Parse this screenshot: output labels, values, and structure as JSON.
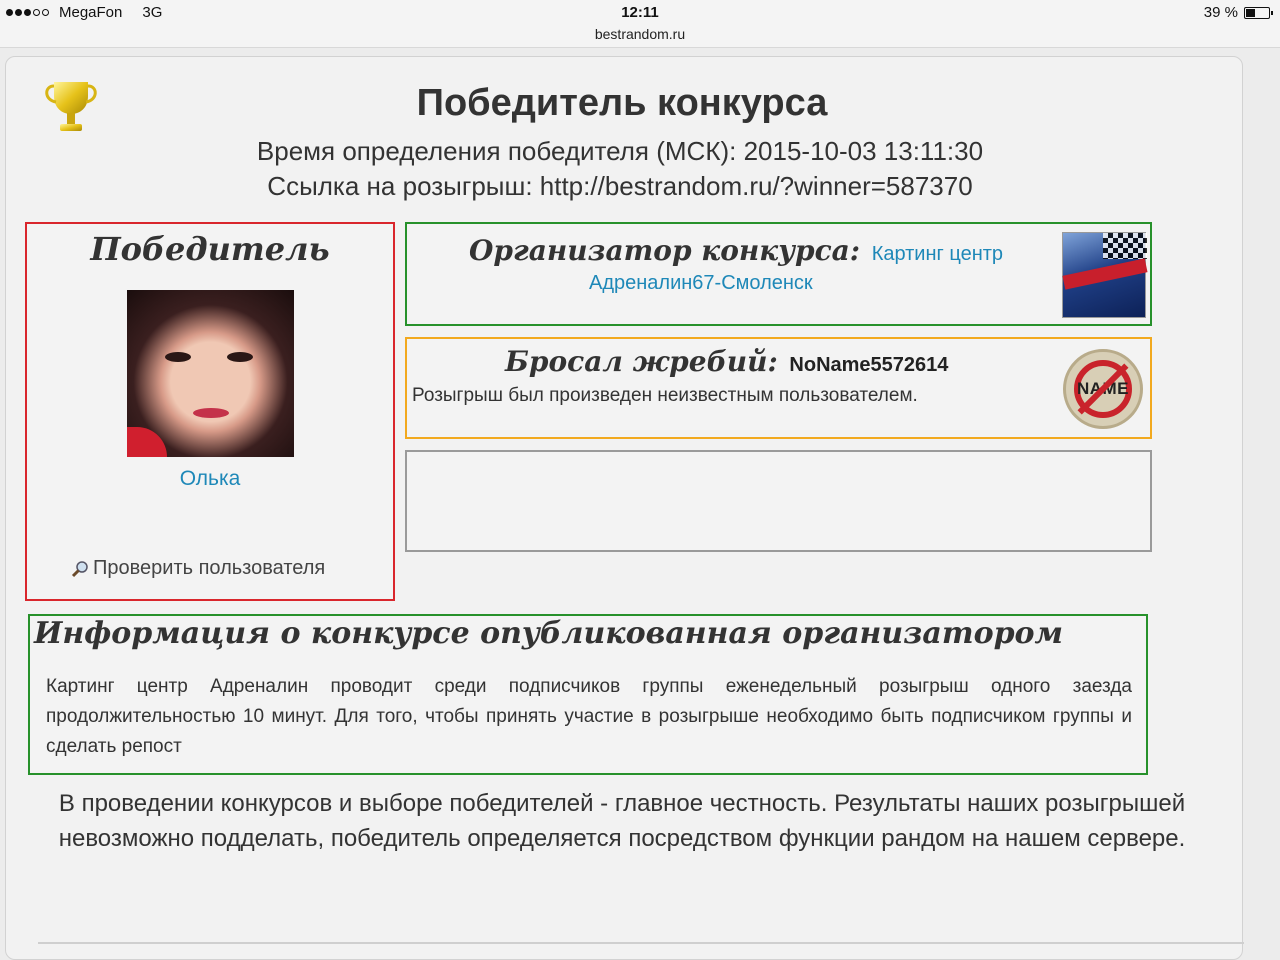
{
  "status_bar": {
    "carrier": "MegaFon",
    "network": "3G",
    "time": "12:11",
    "url": "bestrandom.ru",
    "battery": "39 %",
    "battery_level": 0.39,
    "signal_bars": 3,
    "signal_total": 5
  },
  "page": {
    "title": "Победитель конкурса",
    "time_line": "Время определения победителя (МСК): 2015-10-03 13:11:30",
    "link_line": "Ссылка на розыгрыш: http://bestrandom.ru/?winner=587370",
    "trophy_icon": "trophy-icon"
  },
  "winner": {
    "heading": "Победитель",
    "name": "Олька",
    "check_label": "Проверить пользователя",
    "check_icon": "magnifier-icon"
  },
  "organizer": {
    "heading": "Организатор конкурса:",
    "name_line1": "Картинг центр",
    "name_line2": "Адреналин67-Смоленск"
  },
  "draw": {
    "heading": "Бросал жребий:",
    "user": "NoName5572614",
    "text": "Розыгрыш был произведен неизвестным пользователем.",
    "badge_label": "NAME"
  },
  "info": {
    "heading": "Информация о конкурсе опубликованная организатором",
    "text": "Картинг центр Адреналин проводит среди подписчиков группы еженедельный розыгрыш одного заезда продолжительностью 10 минут. Для того, чтобы принять участие в розыгрыше необходимо быть подписчиком группы и сделать репост"
  },
  "footer": {
    "text": "В проведении конкурсов и выборе победителей - главное честность. Результаты наших розыгрышей невозможно подделать, победитель определяется посредством функции рандом на нашем сервере."
  },
  "colors": {
    "winner_border": "#d9262c",
    "organizer_border": "#27912b",
    "draw_border": "#f2a91e",
    "link": "#1e88b8"
  }
}
